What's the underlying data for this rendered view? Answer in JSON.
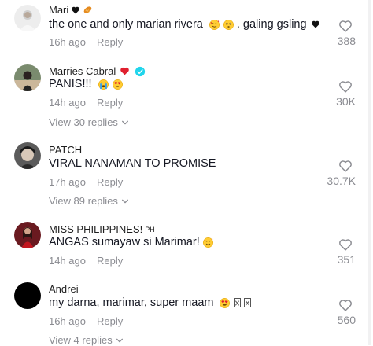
{
  "comments": [
    {
      "username": "Mari",
      "text": "the one and only marian rivera",
      "text_suffix": ". galing gsling",
      "time": "16h ago",
      "reply_label": "Reply",
      "likes": "388"
    },
    {
      "username": "Marries Cabral",
      "text": "PANIS!!!",
      "time": "14h ago",
      "reply_label": "Reply",
      "likes": "30K",
      "view_replies": "View 30 replies"
    },
    {
      "username": "PATCH",
      "text": "VIRAL NANAMAN TO PROMISE",
      "time": "17h ago",
      "reply_label": "Reply",
      "likes": "30.7K",
      "view_replies": "View 89 replies"
    },
    {
      "username": "MISS PHILIPPINES!",
      "username_suffix": "PH",
      "text": "ANGAS sumayaw si Marimar!",
      "time": "14h ago",
      "reply_label": "Reply",
      "likes": "351"
    },
    {
      "username": "Andrei",
      "text": "my darna, marimar, super maam",
      "time": "16h ago",
      "reply_label": "Reply",
      "likes": "560",
      "view_replies": "View 4 replies"
    }
  ],
  "icons": {
    "like": "heart-outline-icon",
    "expand": "chevron-down-icon",
    "verified": "verified-badge-icon"
  },
  "colors": {
    "verified": "#20d5ec",
    "heart_red": "#e0202f",
    "meta_gray": "#8a8b91"
  }
}
